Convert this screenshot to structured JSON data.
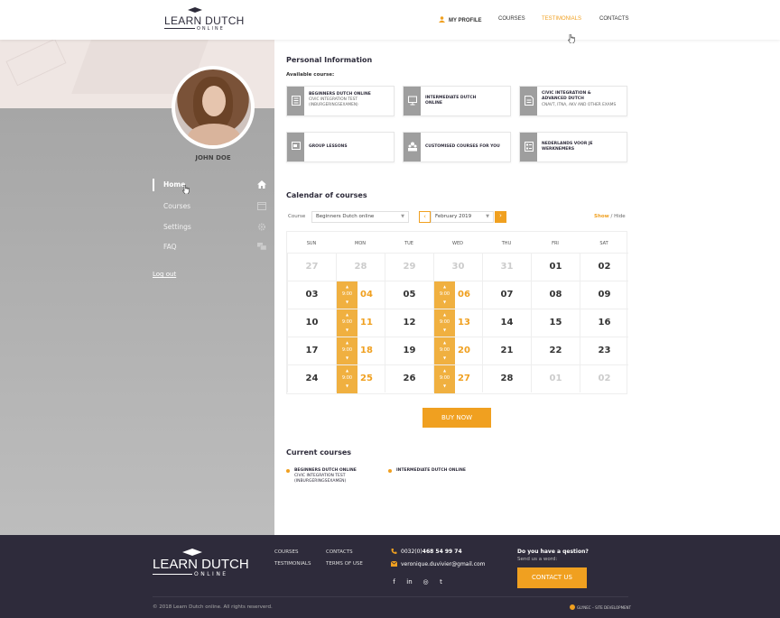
{
  "header": {
    "logo_line1": "LEARN DUTCH",
    "logo_line2": "ONLINE",
    "nav": [
      {
        "label": "MY PROFILE"
      },
      {
        "label": "COURSES"
      },
      {
        "label": "TESTIMONIALS"
      },
      {
        "label": "CONTACTS"
      }
    ],
    "active_nav": "TESTIMONIALS"
  },
  "sidebar": {
    "user_name": "JOHN DOE",
    "menu": [
      {
        "label": "Home",
        "icon": "home-icon"
      },
      {
        "label": "Courses",
        "icon": "window-icon"
      },
      {
        "label": "Settings",
        "icon": "gear-icon"
      },
      {
        "label": "FAQ",
        "icon": "chat-icon"
      }
    ],
    "logout": "Log out"
  },
  "personal": {
    "title": "Personal Information",
    "available_label": "Available course:",
    "cards": [
      {
        "title": "BEGINNERS DUTCH ONLINE",
        "sub": "CIVIC INTEGRATION TEST (INBURGERINGSEXAMEN)",
        "icon": "book-icon"
      },
      {
        "title": "INTERMEDIATE DUTCH ONLINE",
        "sub": "",
        "icon": "monitor-icon"
      },
      {
        "title": "CIVIC INTEGRATION & ADVANCED DUTCH",
        "sub": "CNAVT, ITNA, AKV AND OTHER EXAMS",
        "icon": "document-icon"
      },
      {
        "title": "GROUP LESSONS",
        "sub": "",
        "icon": "presentation-icon"
      },
      {
        "title": "CUSTOMISED COURSES FOR YOU",
        "sub": "",
        "icon": "group-icon"
      },
      {
        "title": "NEDERLANDS VOOR JE WERKNEMERS",
        "sub": "",
        "icon": "checklist-icon"
      }
    ]
  },
  "calendar": {
    "title": "Calendar of courses",
    "course_label": "Course",
    "course_value": "Beginners Dutch online",
    "month_value": "February 2019",
    "prev": "‹",
    "next": "›",
    "show": "Show",
    "sep": "/",
    "hide": "Hide",
    "days": [
      "SUN",
      "MON",
      "TUE",
      "WED",
      "THU",
      "FRI",
      "SAT"
    ],
    "weeks": [
      [
        "27",
        "28",
        "29",
        "30",
        "31",
        "01",
        "02"
      ],
      [
        "03",
        "04",
        "05",
        "06",
        "07",
        "08",
        "09"
      ],
      [
        "10",
        "11",
        "12",
        "13",
        "14",
        "15",
        "16"
      ],
      [
        "17",
        "18",
        "19",
        "20",
        "21",
        "22",
        "23"
      ],
      [
        "24",
        "25",
        "26",
        "27",
        "28",
        "01",
        "02"
      ]
    ],
    "slot_time": "9:00",
    "buy_label": "BUY NOW"
  },
  "current": {
    "title": "Current courses",
    "items": [
      {
        "title": "BEGINNERS DUTCH ONLINE",
        "sub": "CIVIC INTEGRATION TEST (INBURGERINGSEXAMEN)"
      },
      {
        "title": "INTERMEDIATE DUTCH ONLINE",
        "sub": ""
      }
    ]
  },
  "footer": {
    "links": [
      "COURSES",
      "CONTACTS",
      "TESTIMONIALS",
      "TERMS OF USE"
    ],
    "phone_prefix": "0032(0)",
    "phone_main": "468 54 99 74",
    "email": "veronique.duvivier@gmail.com",
    "social": [
      "f",
      "in",
      "◎",
      "t"
    ],
    "question": "Do you have a qestion?",
    "send": "Send us a word:",
    "contact_btn": "CONTACT US",
    "copyright": "© 2018 Learn Dutch online. All rights reserverd.",
    "credit": "GLYNEC – SITE DEVELOPMENT"
  },
  "colors": {
    "accent": "#f0a020",
    "footer_bg": "#2e2b3b",
    "sidebar_bg": "#a6a6a6"
  }
}
